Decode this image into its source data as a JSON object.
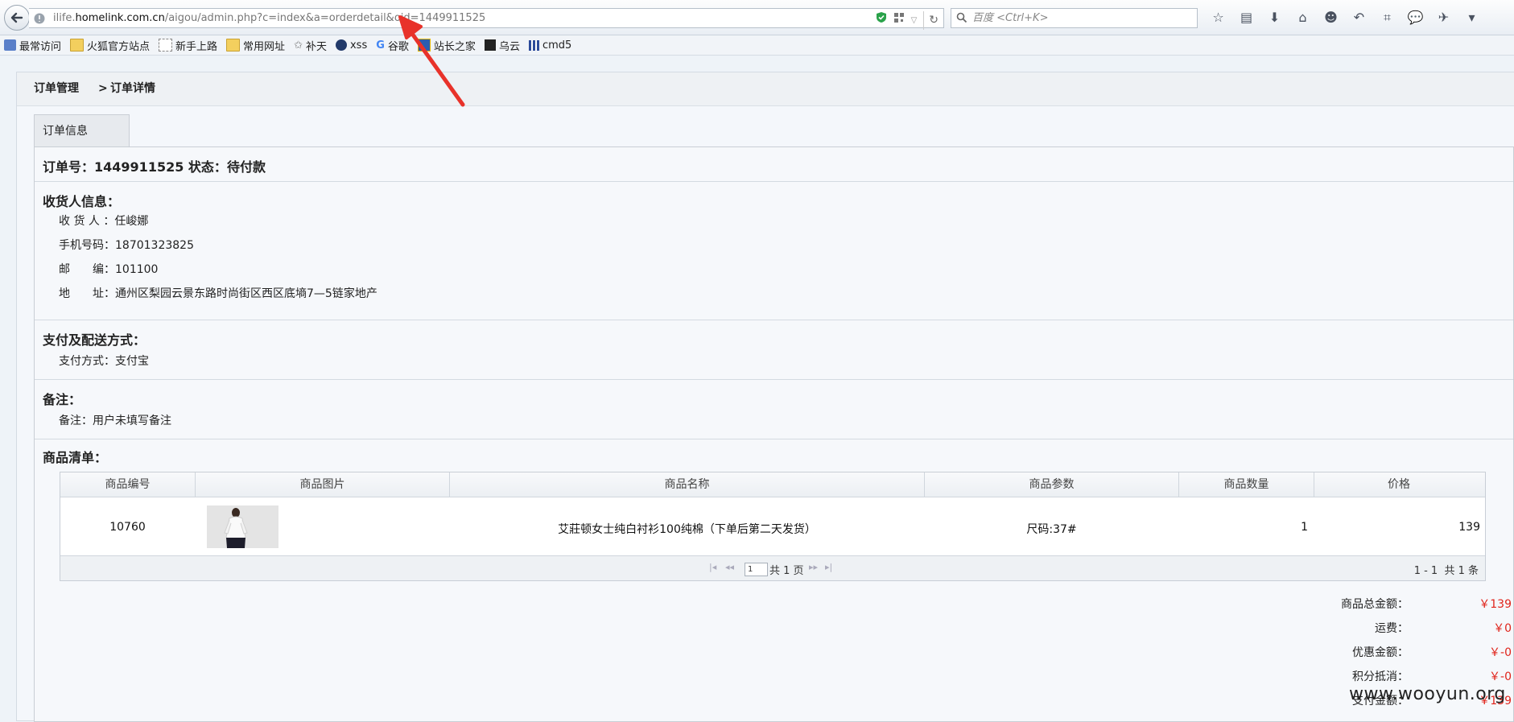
{
  "browser": {
    "url_prefix": "ilife.",
    "url_host": "homelink.com.cn",
    "url_path": "/aigou/admin.php?c=index&a=orderdetail&oid=1449911525",
    "search_placeholder": "百度 <Ctrl+K>",
    "bookmarks": [
      "最常访问",
      "火狐官方站点",
      "新手上路",
      "常用网址",
      "补天",
      "xss",
      "谷歌",
      "站长之家",
      "乌云",
      "cmd5"
    ]
  },
  "breadcrumb": {
    "parent": "订单管理",
    "separator": ">",
    "current": "订单详情"
  },
  "tab": {
    "label": "订单信息"
  },
  "order": {
    "id_label": "订单号：",
    "id": "1449911525",
    "status_label": "状态：",
    "status": "待付款"
  },
  "receiver": {
    "heading": "收货人信息：",
    "name_label": "收 货 人 ：",
    "name": "任峻娜",
    "phone_label": "手机号码：",
    "phone": "18701323825",
    "zip_label": "邮　　编：",
    "zip": "101100",
    "address_label": "地　　址：",
    "address": "通州区梨园云景东路时尚街区西区底墒7—5链家地产"
  },
  "payment": {
    "heading": "支付及配送方式：",
    "method_label": "支付方式：",
    "method": "支付宝"
  },
  "remark": {
    "heading": "备注：",
    "label": "备注：",
    "text": "用户未填写备注"
  },
  "products": {
    "heading": "商品清单：",
    "columns": [
      "商品编号",
      "商品图片",
      "商品名称",
      "商品参数",
      "商品数量",
      "价格"
    ],
    "rows": [
      {
        "id": "10760",
        "name": "艾莊顿女士纯白衬衫100纯棉（下单后第二天发货）",
        "param": "尺码:37#",
        "qty": "1",
        "price": "139"
      }
    ],
    "pager": {
      "page": "1",
      "total_pages_text": "共 1 页",
      "range_text": "1 - 1",
      "total_text": "共 1 条"
    }
  },
  "totals": {
    "subtotal_label": "商品总金额：",
    "subtotal": "￥139",
    "shipping_label": "运费：",
    "shipping": "￥0",
    "discount_label": "优惠金额：",
    "discount": "￥-0",
    "points_label": "积分抵消：",
    "points": "￥-0",
    "pay_label": "支付金额：",
    "pay": "￥139"
  },
  "watermark": "www.wooyun.org",
  "colors": {
    "accent_red": "#e0241b",
    "arrow_red": "#e8322a"
  }
}
